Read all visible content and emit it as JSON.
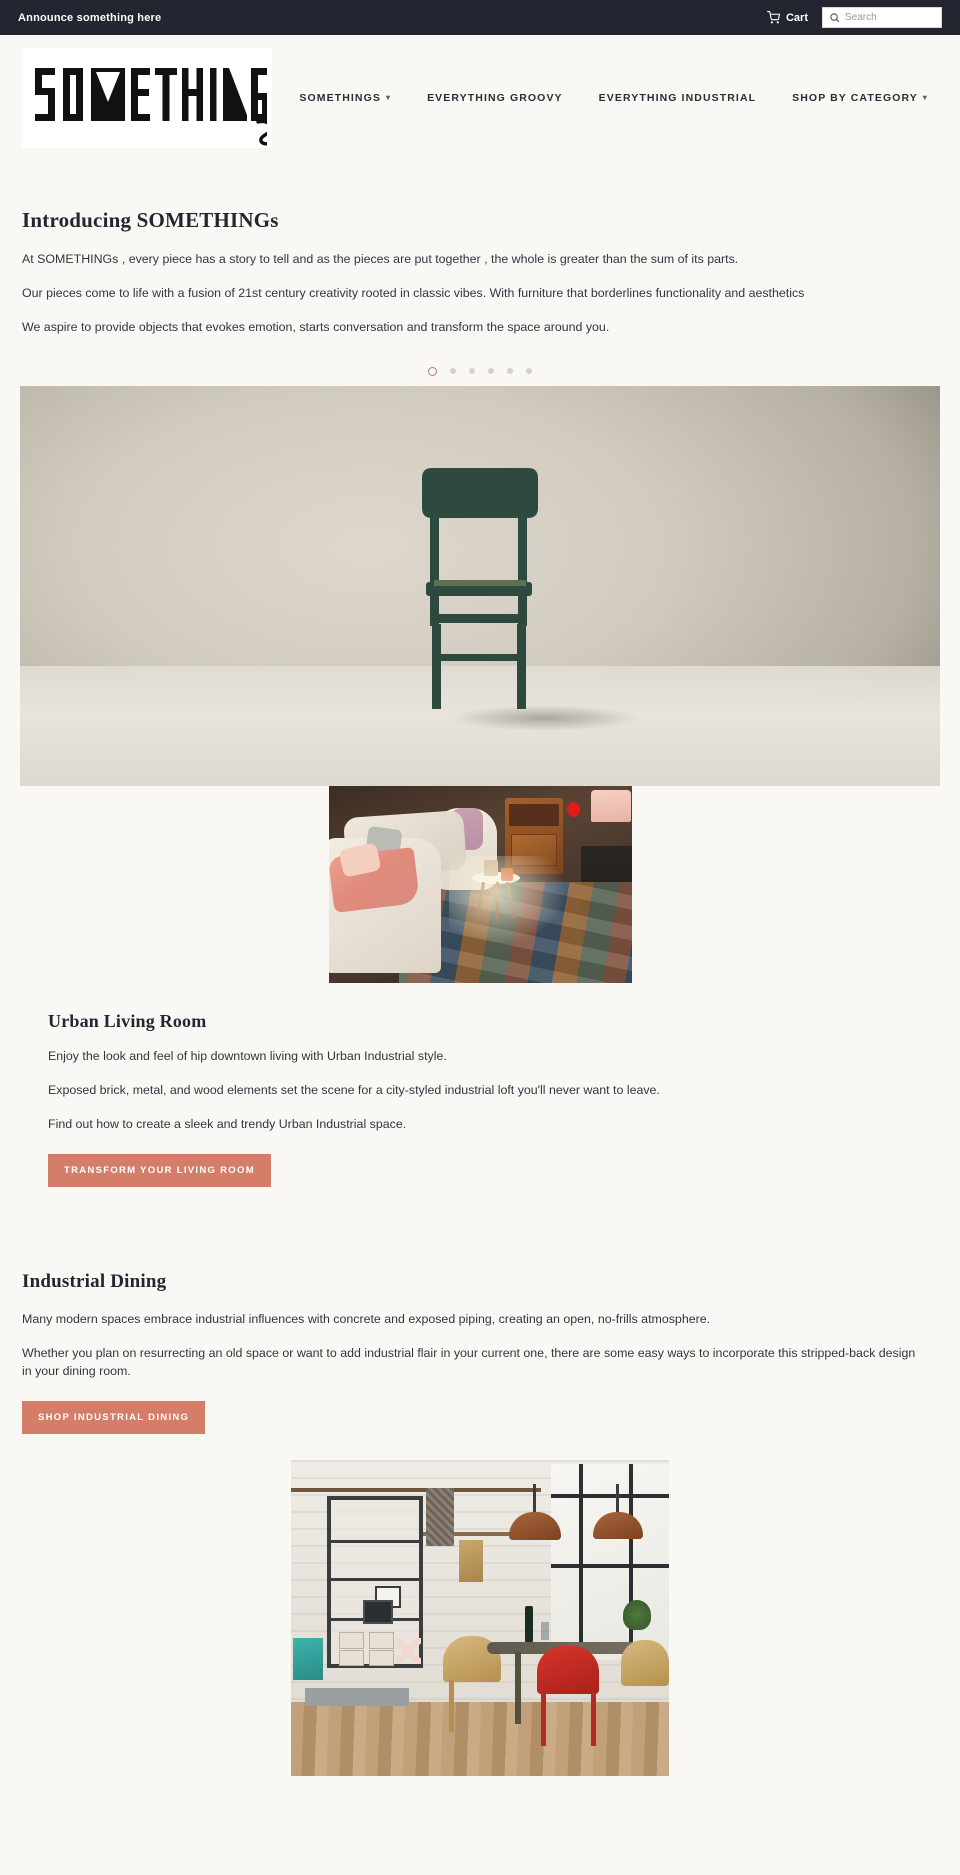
{
  "announcement": {
    "text": "Announce something here",
    "cart_label": "Cart",
    "cart_icon": "shopping-cart-icon",
    "search_icon": "search-icon",
    "search_placeholder": "Search",
    "search_value": "",
    "background_color": "#232530"
  },
  "header": {
    "logo_text": "SOMETHINGs",
    "nav": [
      {
        "label": "SOMETHINGS",
        "has_dropdown": true
      },
      {
        "label": "EVERYTHING GROOVY",
        "has_dropdown": false
      },
      {
        "label": "EVERYTHING INDUSTRIAL",
        "has_dropdown": false
      },
      {
        "label": "SHOP BY CATEGORY",
        "has_dropdown": true
      }
    ]
  },
  "intro": {
    "title": "Introducing SOMETHINGs",
    "paragraphs": [
      "At SOMETHINGs , every piece has a story to tell and as the pieces are put together , the whole is greater than the sum of its parts.",
      "Our pieces come to life with a fusion of 21st century creativity rooted in classic vibes. With furniture that borderlines functionality and aesthetics",
      "We aspire to provide objects that evokes emotion, starts conversation and transform the space around you."
    ]
  },
  "carousel": {
    "total_dots": 6,
    "active_index": 0,
    "active_color": "#b4796a",
    "inactive_color": "#d6d1cc",
    "slide_alt": "dark green wooden chair against a beige wall"
  },
  "living_room": {
    "image_alt": "cozy urban living room with cream sofas, pink throw and patchwork rug",
    "title": "Urban Living Room",
    "paragraphs": [
      "Enjoy the look and feel of hip downtown living with Urban Industrial style.",
      "Exposed brick, metal, and wood elements set the scene for a city-styled industrial loft you'll never want to leave.",
      "Find out how to create a sleek and trendy Urban Industrial space."
    ],
    "button_label": "TRANSFORM YOUR LIVING ROOM"
  },
  "industrial_dining": {
    "title": "Industrial Dining",
    "paragraphs": [
      "Many modern spaces embrace industrial influences with concrete and exposed piping, creating an open, no-frills atmosphere.",
      "Whether you plan on resurrecting an old space or want to add industrial flair in your current one, there are some easy ways to incorporate this stripped-back design in your dining room."
    ],
    "button_label": "SHOP INDUSTRIAL DINING",
    "image_alt": "industrial dining room with copper pendant lights, metal shelving and red chair"
  },
  "theme": {
    "page_background": "#faf8f5",
    "accent_color": "#d47e6a",
    "text_color": "#2b2d36"
  }
}
